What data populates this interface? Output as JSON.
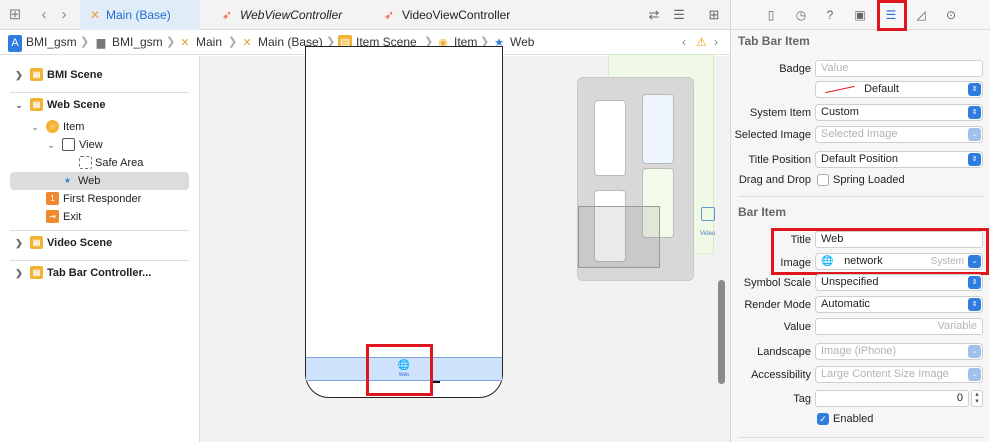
{
  "editor_tabs": [
    {
      "label": "Main (Base)",
      "icon": "xmark-storyboard-icon",
      "active": true
    },
    {
      "label": "WebViewController",
      "icon": "swift-icon",
      "active": false
    },
    {
      "label": "VideoViewController",
      "icon": "swift-icon",
      "active": false
    }
  ],
  "breadcrumb": [
    "BMI_gsm",
    "BMI_gsm",
    "Main",
    "Main (Base)",
    "Item Scene",
    "Item",
    "Web"
  ],
  "outline": {
    "scenes": [
      {
        "label": "BMI Scene"
      },
      {
        "label": "Web Scene"
      },
      {
        "label": "Video Scene"
      },
      {
        "label": "Tab Bar Controller..."
      }
    ],
    "web_children": {
      "item": "Item",
      "view": "View",
      "safe_area": "Safe Area",
      "web": "Web",
      "first_responder": "First Responder",
      "exit": "Exit"
    }
  },
  "canvas": {
    "tab_label": "Web",
    "mini_label": "Video"
  },
  "inspector": {
    "tab_bar_item": {
      "header": "Tab Bar Item",
      "badge_label": "Badge",
      "badge_placeholder": "Value",
      "color_value": "Default",
      "system_item_label": "System Item",
      "system_item_value": "Custom",
      "selected_image_label": "Selected Image",
      "selected_image_value": "Selected Image",
      "title_position_label": "Title Position",
      "title_position_value": "Default Position",
      "drag_drop_label": "Drag and Drop",
      "spring_loaded_label": "Spring Loaded"
    },
    "bar_item": {
      "header": "Bar Item",
      "title_label": "Title",
      "title_value": "Web",
      "image_label": "Image",
      "image_value": "network",
      "image_hint": "System",
      "symbol_scale_label": "Symbol Scale",
      "symbol_scale_value": "Unspecified",
      "render_mode_label": "Render Mode",
      "render_mode_value": "Automatic",
      "value_label": "Value",
      "value_placeholder": "Variable",
      "landscape_label": "Landscape",
      "landscape_value": "Image (iPhone)",
      "accessibility_label": "Accessibility",
      "accessibility_value": "Large Content Size Image",
      "tag_label": "Tag",
      "tag_value": "0",
      "enabled_label": "Enabled"
    }
  },
  "colors": {
    "accent": "#2f7de0",
    "highlight": "#e0161e",
    "tab_active_bg": "#e1ecf9"
  }
}
